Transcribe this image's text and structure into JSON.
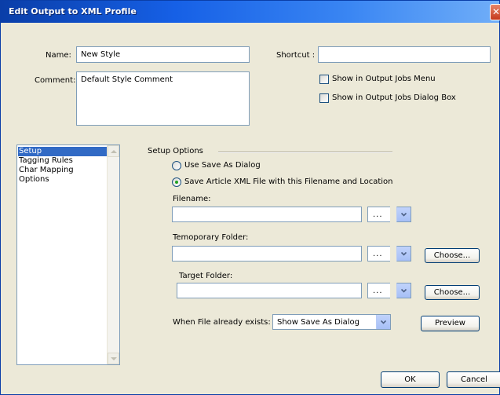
{
  "window": {
    "title": "Edit Output to XML Profile",
    "close_glyph": "✕"
  },
  "profile": {
    "name_label": "Name:",
    "name_value": "New Style",
    "shortcut_label": "Shortcut :",
    "shortcut_value": "",
    "comment_label": "Comment:",
    "comment_value": "Default Style Comment",
    "show_in_menu_label": "Show in Output Jobs Menu",
    "show_in_menu_checked": false,
    "show_in_dialog_label": "Show in Output Jobs Dialog Box",
    "show_in_dialog_checked": false
  },
  "sections": {
    "items": [
      {
        "label": "Setup",
        "selected": true
      },
      {
        "label": "Tagging Rules",
        "selected": false
      },
      {
        "label": "Char Mapping",
        "selected": false
      },
      {
        "label": "Options",
        "selected": false
      }
    ]
  },
  "setup": {
    "group_label": "Setup Options",
    "radio_save_as_dialog": "Use Save As Dialog",
    "radio_save_article": "Save Article XML File with this Filename and Location",
    "selected_radio": "save_article",
    "filename_label": "Filename:",
    "filename_value": "",
    "temp_folder_label": "Temoporary Folder:",
    "temp_folder_value": "",
    "target_folder_label": "Target Folder:",
    "target_folder_value": "",
    "dots": "...",
    "choose_label": "Choose...",
    "when_exists_label": "When File already exists:",
    "when_exists_value": "Show Save As Dialog",
    "preview_label": "Preview"
  },
  "footer": {
    "ok_label": "OK",
    "cancel_label": "Cancel"
  },
  "colors": {
    "title_bar": "#1660e6",
    "dialog_bg": "#ece9d8",
    "selection": "#316ac5",
    "close_button": "#c5391c"
  }
}
